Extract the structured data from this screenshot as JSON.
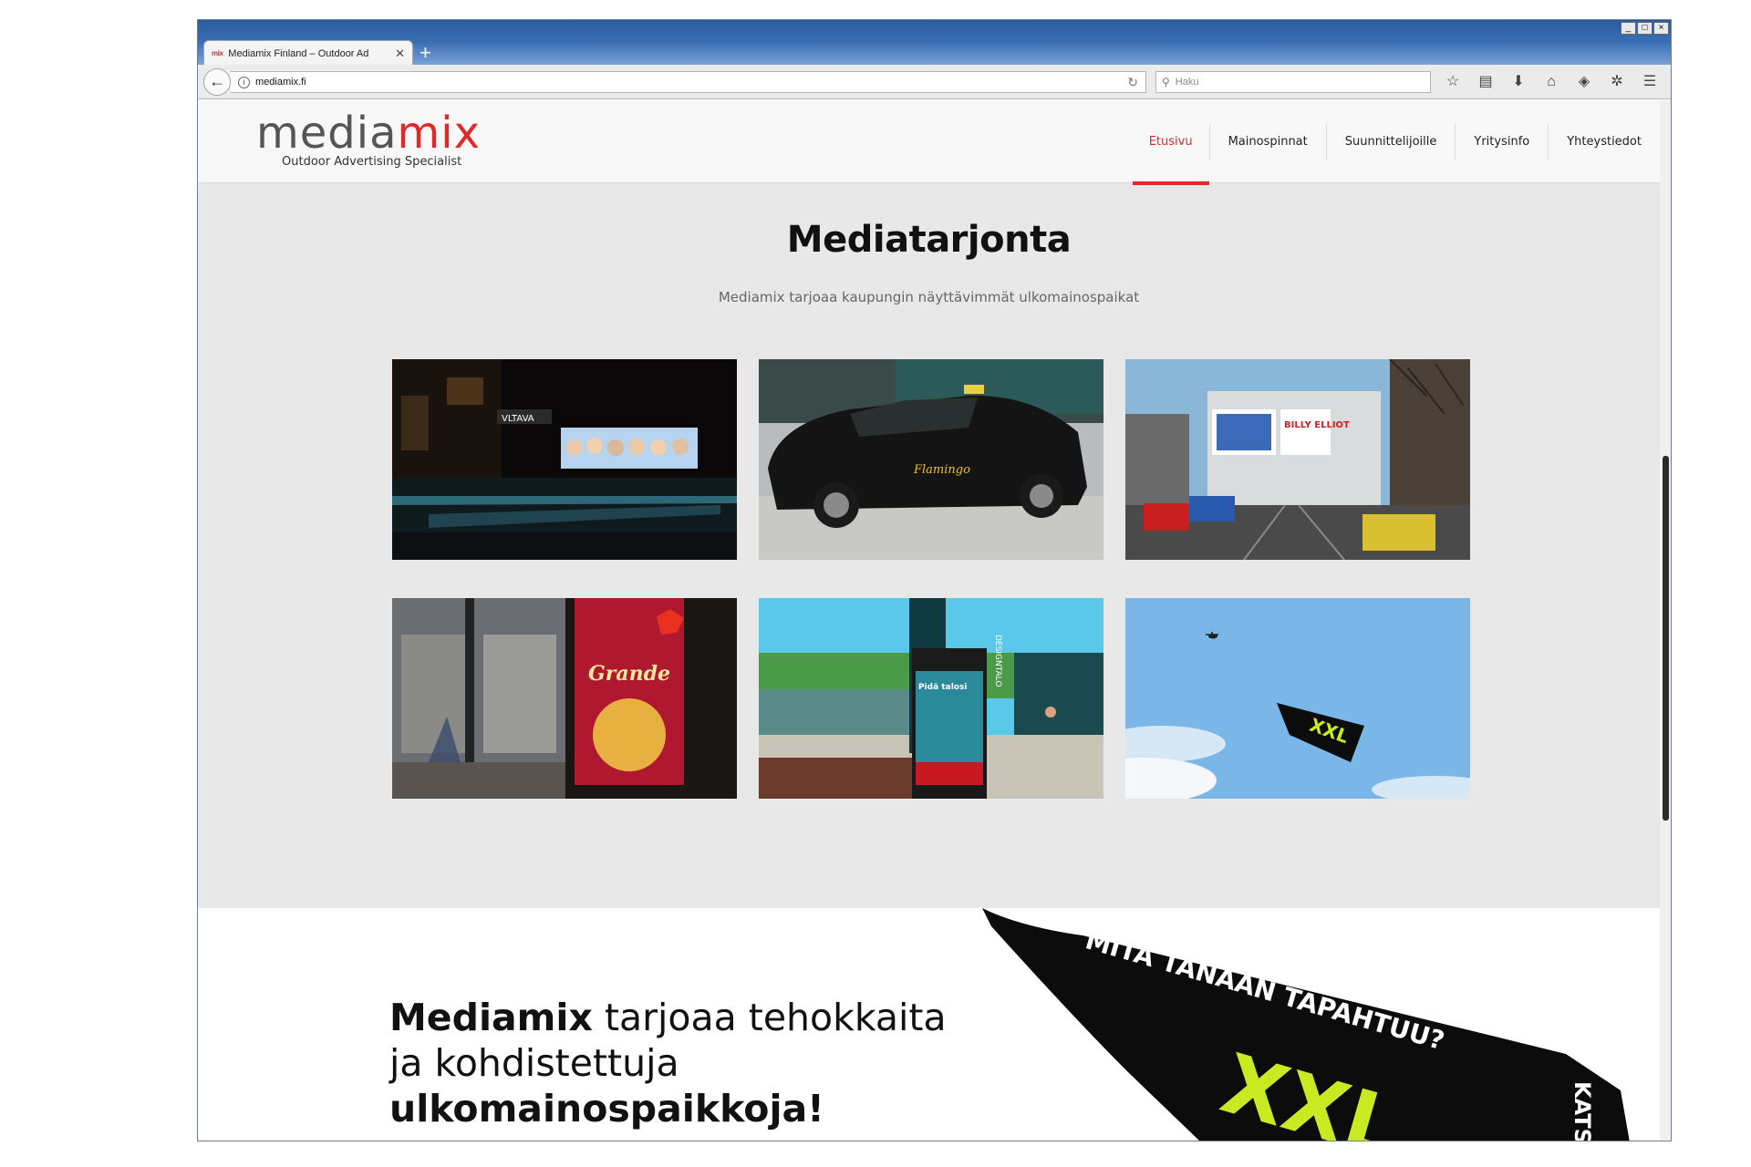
{
  "browser": {
    "tab_title": "Mediamix Finland – Outdoor Ad",
    "tab_favicon": "mix",
    "url": "mediamix.fi",
    "search_placeholder": "Haku",
    "window_controls": [
      "_",
      "□",
      "×"
    ]
  },
  "site": {
    "logo_word_a": "media",
    "logo_word_b": "mix",
    "logo_tagline": "Outdoor Advertising Specialist",
    "nav": [
      {
        "label": "Etusivu",
        "active": true
      },
      {
        "label": "Mainospinnat",
        "active": false
      },
      {
        "label": "Suunnittelijoille",
        "active": false
      },
      {
        "label": "Yritysinfo",
        "active": false
      },
      {
        "label": "Yhteystiedot",
        "active": false
      }
    ],
    "accent_color": "#e02a2a"
  },
  "media": {
    "title": "Mediatarjonta",
    "subtitle": "Mediamix tarjoaa kaupungin näyttävimmät ulkomainospaikat",
    "tiles": [
      {
        "name": "bus-stop-night",
        "poster_sign": "VLTAVA"
      },
      {
        "name": "taxi-ad",
        "car_text": "Flamingo"
      },
      {
        "name": "city-billboard",
        "billboard_text": "BILLY ELLIOT"
      },
      {
        "name": "station-screen",
        "ad_text": "Grande"
      },
      {
        "name": "outdoor-kiosk",
        "sign_text": "DESIGNTALO"
      },
      {
        "name": "helicopter-banner",
        "banner_text": "XXL"
      }
    ]
  },
  "promo": {
    "line1_bold": "Mediamix",
    "line1_rest": " tarjoaa  tehokkaita",
    "line2": "ja kohdistettuja",
    "line3_bold": "ulkomainospaikkoja!",
    "banner_text": "MITÄ TÄNÄÄN TAPAHTUU?",
    "banner_side": "KATS",
    "banner_logo": "XXL"
  }
}
